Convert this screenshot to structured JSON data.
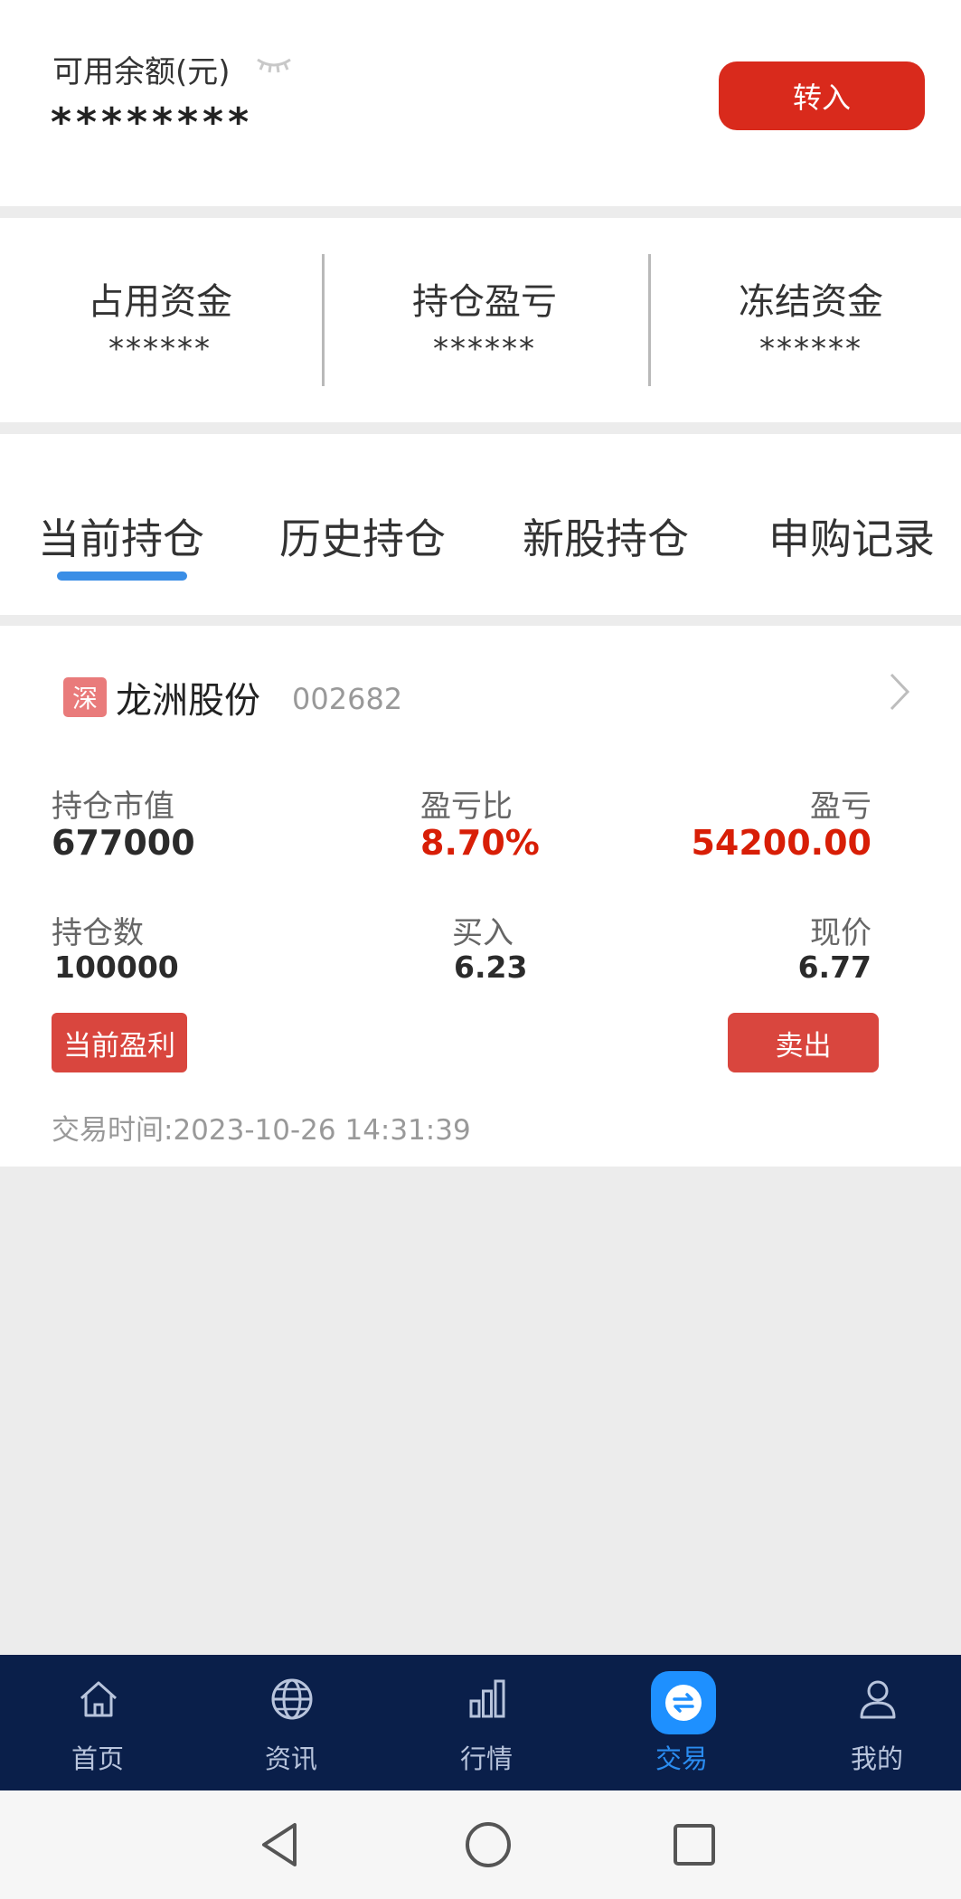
{
  "balance": {
    "label": "可用余额(元)",
    "value": "********",
    "eye_icon": "eye-closed-icon",
    "transfer_button": "转入"
  },
  "stats": [
    {
      "label": "占用资金",
      "value": "******"
    },
    {
      "label": "持仓盈亏",
      "value": "******"
    },
    {
      "label": "冻结资金",
      "value": "******"
    }
  ],
  "tabs": [
    {
      "label": "当前持仓",
      "active": true
    },
    {
      "label": "历史持仓",
      "active": false
    },
    {
      "label": "新股持仓",
      "active": false
    },
    {
      "label": "申购记录",
      "active": false
    }
  ],
  "holding": {
    "market_badge": "深",
    "name": "龙洲股份",
    "code": "002682",
    "market_value_label": "持仓市值",
    "market_value": "677000",
    "pnl_ratio_label": "盈亏比",
    "pnl_ratio": "8.70%",
    "pnl_label": "盈亏",
    "pnl": "54200.00",
    "quantity_label": "持仓数",
    "quantity": "100000",
    "buy_label": "买入",
    "buy_price": "6.23",
    "current_label": "现价",
    "current_price": "6.77",
    "profit_button": "当前盈利",
    "sell_button": "卖出",
    "trade_time_label": "交易时间:",
    "trade_time": "2023-10-26 14:31:39"
  },
  "bottom_nav": [
    {
      "label": "首页",
      "icon": "home-icon",
      "active": false
    },
    {
      "label": "资讯",
      "icon": "globe-icon",
      "active": false
    },
    {
      "label": "行情",
      "icon": "bar-chart-icon",
      "active": false
    },
    {
      "label": "交易",
      "icon": "exchange-icon",
      "active": true
    },
    {
      "label": "我的",
      "icon": "user-icon",
      "active": false
    }
  ],
  "colors": {
    "accent_red": "#d92a1c",
    "profit_red": "#d81e06",
    "tab_blue": "#3a8ee6",
    "nav_bg": "#0a1f4a",
    "nav_active": "#2a8cf0"
  }
}
